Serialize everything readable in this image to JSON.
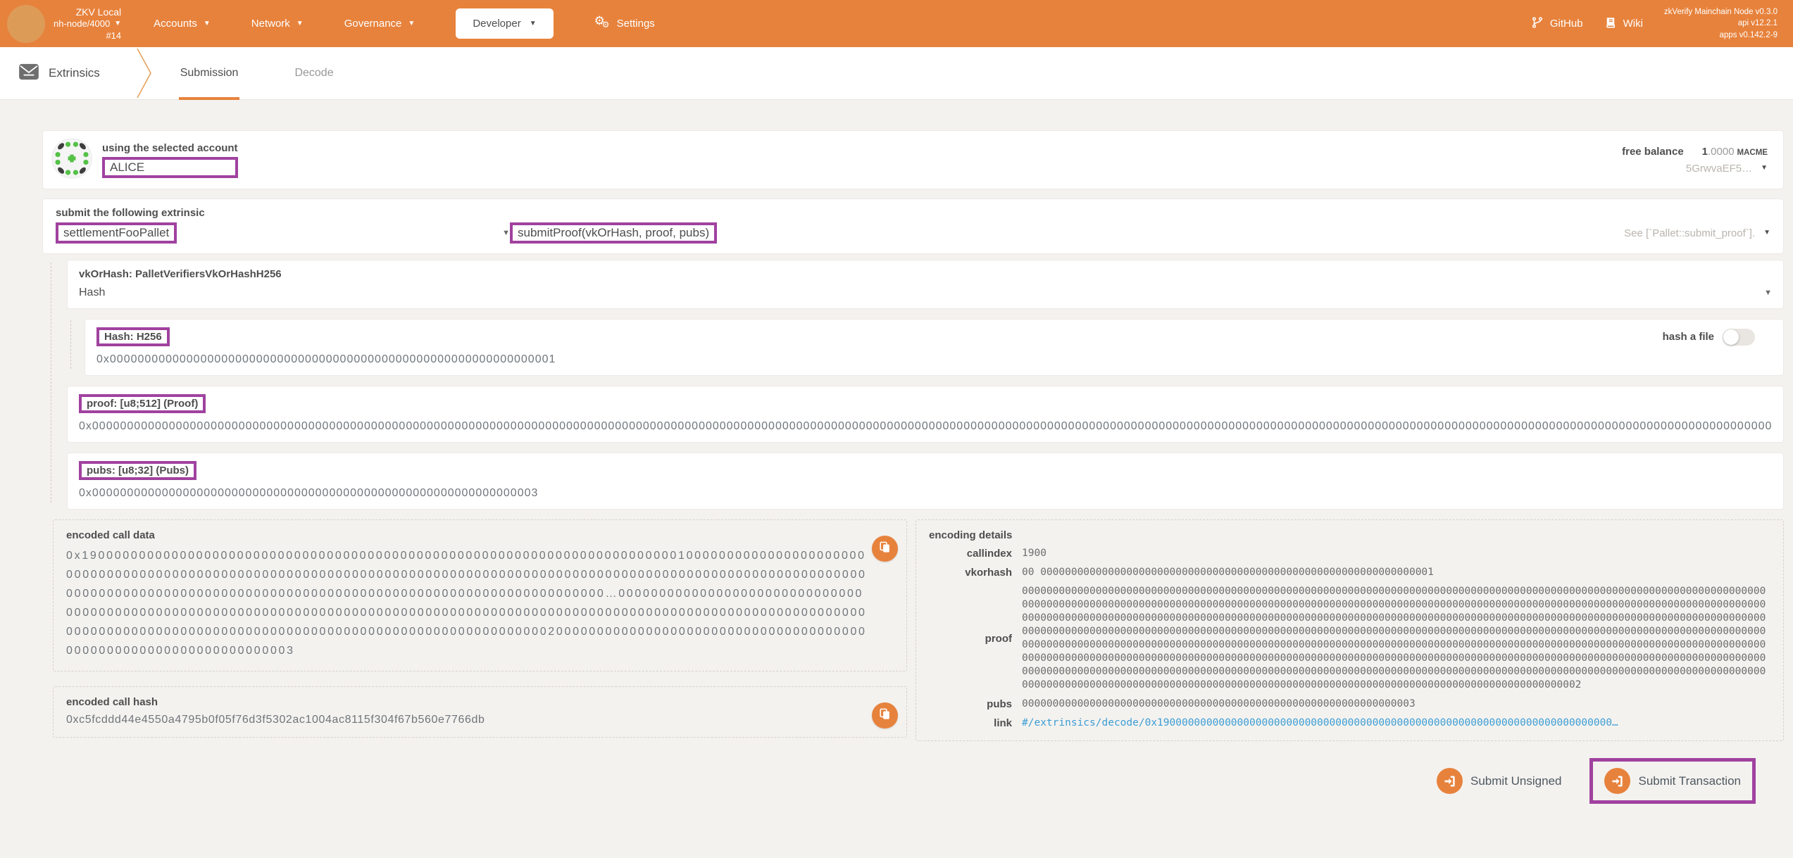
{
  "header": {
    "network": "ZKV Local",
    "node": "nh-node/4000",
    "block": "#14",
    "nav": {
      "accounts": "Accounts",
      "network": "Network",
      "governance": "Governance",
      "developer": "Developer",
      "settings": "Settings"
    },
    "links": {
      "github": "GitHub",
      "wiki": "Wiki"
    },
    "versions": {
      "node": "zkVerify Mainchain Node v0.3.0",
      "api": "api v12.2.1",
      "apps": "apps v0.142.2-9"
    }
  },
  "tabbar": {
    "section": "Extrinsics",
    "tabs": [
      {
        "label": "Submission"
      },
      {
        "label": "Decode"
      }
    ]
  },
  "account": {
    "label": "using the selected account",
    "name": "ALICE",
    "balance_label": "free balance",
    "balance_int": "1",
    "balance_frac": ".0000",
    "balance_unit": "MACME",
    "address": "5GrwvaEF5…"
  },
  "extrinsic": {
    "label": "submit the following extrinsic",
    "pallet": "settlementFooPallet",
    "method": "submitProof(vkOrHash, proof, pubs)",
    "doc": "See [`Pallet::submit_proof`]."
  },
  "params": {
    "vkorhash": {
      "title": "vkOrHash: PalletVerifiersVkOrHashH256",
      "selected": "Hash"
    },
    "hash": {
      "label": "Hash: H256",
      "toggle_label": "hash a file",
      "value": "0x0000000000000000000000000000000000000000000000000000000000000001"
    },
    "proof": {
      "label": "proof: [u8;512] (Proof)",
      "value": "0x00000000000000000000000000000000000000000000000000000000000000000000000000000000000000000000000000000000000000000000000000000000000000000000000000000000000000000000000000000000000000000000000000000000000000000000000000000000000000000000000000000000000000000000000000000000000000000000000000000000000000000000000000000000000000000000000000000000000000000000000000000000000000000000000000000000000000000000000000000000000000000000000000000000000000000000000000000000000000000000000000000000000000000000000000000000000000000000000000000000000000000000000000000000000000000000000000000000000000000000000000000000000000000000000000000000000000000000000000000000000000000000000000000000000000000000000000000000000000000000000000000000000000000000000000000000000000000000000000000000000000000000000000000000000000000000000000000000000000000000000000000000000000000000000000000000000000000000000000000000000000000000000000000000000000000000000002"
    },
    "pubs": {
      "label": "pubs: [u8;32] (Pubs)",
      "value": "0x0000000000000000000000000000000000000000000000000000000000000003"
    }
  },
  "outputs": {
    "call_data_label": "encoded call data",
    "call_data": "0x19000000000000000000000000000000000000000000000000000000000000000000000001000000000000000000000000000000000000000000000000000000000000000000000000000000000000000000000000000000000000000000000000000000000000000000000000000000000000000000000000000000000000000000…00000000000000000000000000000000000000000000000000000000000000000000000000000000000000000000000000000000000000000000000000000000000000000000000000000000000000000000000000000000000000000002000000000000000000000000000000000000000000000000000000000000000003",
    "call_hash_label": "encoded call hash",
    "call_hash": "0xc5fcddd44e4550a4795b0f05f76d3f5302ac1004ac8115f304f67b560e7766db",
    "details_title": "encoding details",
    "details": {
      "rows": [
        {
          "label": "callindex",
          "value": "1900"
        },
        {
          "label": "vkorhash",
          "value": "00 0000000000000000000000000000000000000000000000000000000000000001"
        },
        {
          "label": "proof",
          "value": "00000000000000000000000000000000000000000000000000000000000000000000000000000000000000000000000000000000000000000000000000000000000000000000000000000000000000000000000000000000000000000000000000000000000000000000000000000000000000000000000000000000000000000000000000000000000000000000000000000000000000000000000000000000000000000000000000000000000000000000000000000000000000000000000000000000000000000000000000000000000000000000000000000000000000000000000000000000000000000000000000000000000000000000000000000000000000000000000000000000000000000000000000000000000000000000000000000000000000000000000000000000000000000000000000000000000000000000000000000000000000000000000000000000000000000000000000000000000000000000000000000000000000000000000000000000000000000000000000000000000000000000000000000000000000000000000000000000000000000000000000000000000000000000000000000000000000000000000000000000000000000000000000000000000000000000000002"
        },
        {
          "label": "pubs",
          "value": "0000000000000000000000000000000000000000000000000000000000000003"
        },
        {
          "label": "link",
          "value": "#/extrinsics/decode/0x19000000000000000000000000000000000000000000000000000000000000000000000000…"
        }
      ]
    }
  },
  "actions": {
    "unsigned": "Submit Unsigned",
    "signed": "Submit Transaction"
  },
  "colors": {
    "accent_orange": "#e7823c",
    "annotation_purple": "#a0429f",
    "link_blue": "#3c9dd4",
    "identicon_green": "#54c147"
  }
}
